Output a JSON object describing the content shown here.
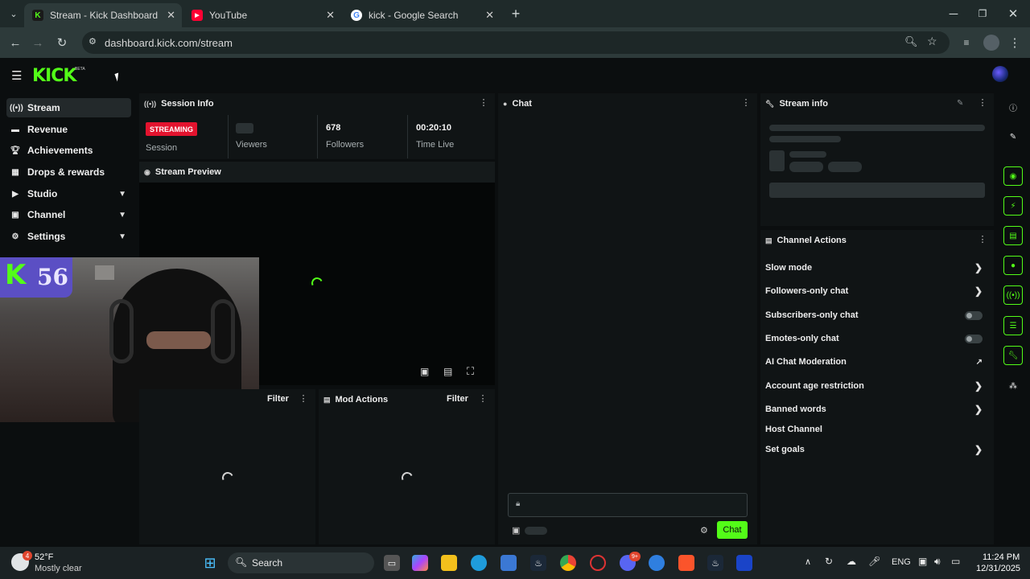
{
  "browser": {
    "tabs": [
      {
        "title": "Stream - Kick Dashboard",
        "active": true
      },
      {
        "title": "YouTube",
        "active": false
      },
      {
        "title": "kick - Google Search",
        "active": false
      }
    ],
    "url": "dashboard.kick.com/stream"
  },
  "kick": {
    "logo": "KICK",
    "beta": "BETA"
  },
  "sidebar": {
    "items": [
      {
        "label": "Stream",
        "icon": "broadcast-icon"
      },
      {
        "label": "Revenue",
        "icon": "money-icon"
      },
      {
        "label": "Achievements",
        "icon": "trophy-icon"
      },
      {
        "label": "Drops & rewards",
        "icon": "gift-icon"
      },
      {
        "label": "Studio",
        "icon": "play-icon"
      },
      {
        "label": "Channel",
        "icon": "channel-icon"
      },
      {
        "label": "Settings",
        "icon": "gear-icon"
      }
    ]
  },
  "session": {
    "title": "Session Info",
    "badge": "STREAMING",
    "session_label": "Session",
    "viewers_label": "Viewers",
    "followers_value": "678",
    "followers_label": "Followers",
    "time_value": "00:20:10",
    "time_label": "Time Live"
  },
  "preview": {
    "title": "Stream Preview"
  },
  "webcam": {
    "badge_number": "56"
  },
  "lower": {
    "filter_label": "Filter",
    "mod_actions_title": "Mod Actions",
    "mod_filter_label": "Filter"
  },
  "chat": {
    "title": "Chat",
    "send_label": "Chat"
  },
  "stream_info": {
    "title": "Stream info"
  },
  "channel_actions": {
    "title": "Channel Actions",
    "rows": [
      "Slow mode",
      "Followers-only chat",
      "Subscribers-only chat",
      "Emotes-only chat",
      "AI Chat Moderation",
      "Account age restriction",
      "Banned words",
      "Host Channel",
      "Set goals"
    ]
  },
  "taskbar": {
    "weather_temp": "52°F",
    "weather_desc": "Mostly clear",
    "weather_badge": "4",
    "search_label": "Search",
    "language": "ENG",
    "time": "11:24 PM",
    "date": "12/31/2025",
    "discord_badge": "9+"
  },
  "colors": {
    "kick_green": "#53fc18",
    "streaming_red": "#e3132e",
    "panel_bg": "#101415",
    "page_bg": "#0b0e0f"
  }
}
